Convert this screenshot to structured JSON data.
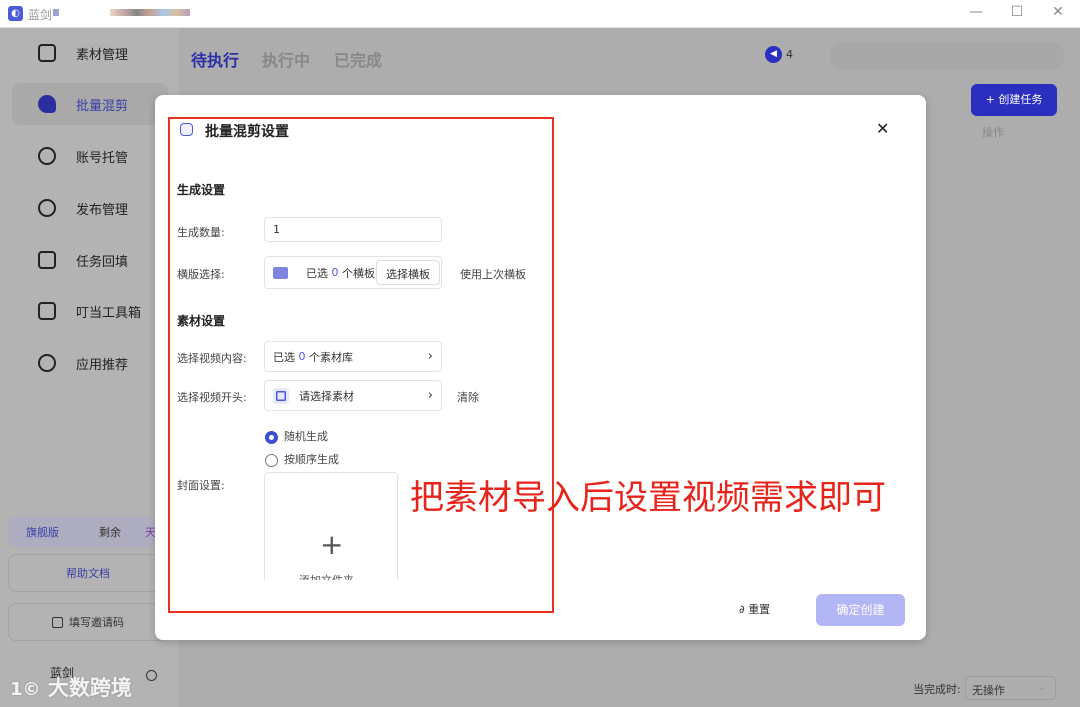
{
  "app": {
    "title": "蓝剑",
    "window_controls": [
      "minimize",
      "maximize",
      "close"
    ]
  },
  "sidebar": {
    "items": [
      {
        "label": "素材管理",
        "icon": "file-icon"
      },
      {
        "label": "批量混剪",
        "icon": "mix-icon",
        "active": true
      },
      {
        "label": "账号托管",
        "icon": "user-icon"
      },
      {
        "label": "发布管理",
        "icon": "publish-icon"
      },
      {
        "label": "任务回填",
        "icon": "checkbox-icon"
      },
      {
        "label": "叮当工具箱",
        "icon": "toolbox-icon"
      },
      {
        "label": "应用推荐",
        "icon": "recommend-icon"
      }
    ],
    "plan": {
      "name": "旗舰版",
      "remain": "剩余",
      "unit": "天"
    },
    "help": "帮助文档",
    "invite": "填写邀请码",
    "user": {
      "name": "蓝剑"
    }
  },
  "tabs": [
    {
      "label": "待执行",
      "active": true
    },
    {
      "label": "执行中"
    },
    {
      "label": "已完成"
    }
  ],
  "notice": {
    "prefix": "4"
  },
  "create_button": "+ 创建任务",
  "column_ops": "操作",
  "footer": {
    "label": "当完成时:",
    "select": "无操作"
  },
  "modal": {
    "title": "批量混剪设置",
    "section1": "生成设置",
    "count": {
      "label": "生成数量:",
      "value": "1"
    },
    "template": {
      "label": "横版选择:",
      "selected_prefix": "已选",
      "selected_count": "0",
      "selected_suffix": "个横板",
      "choose": "选择横板",
      "use_last": "使用上次横板"
    },
    "section2": "素材设置",
    "video_content": {
      "label": "选择视频内容:",
      "prefix": "已选",
      "count": "0",
      "suffix": "个素材库"
    },
    "video_intro": {
      "label": "选择视频开头:",
      "placeholder": "请选择素材",
      "clear": "清除"
    },
    "order": {
      "options": [
        "随机生成",
        "按顺序生成"
      ],
      "selected": "随机生成"
    },
    "cover": {
      "label": "封面设置:",
      "add": "添加文件夹"
    },
    "reset": "重置",
    "confirm": "确定创建"
  },
  "annotation": "把素材导入后设置视频需求即可",
  "watermark": "大数跨境",
  "colors": {
    "accent": "#2a2fc0",
    "annotation": "#e8231a",
    "confirm_disabled": "#b3b6f5"
  }
}
